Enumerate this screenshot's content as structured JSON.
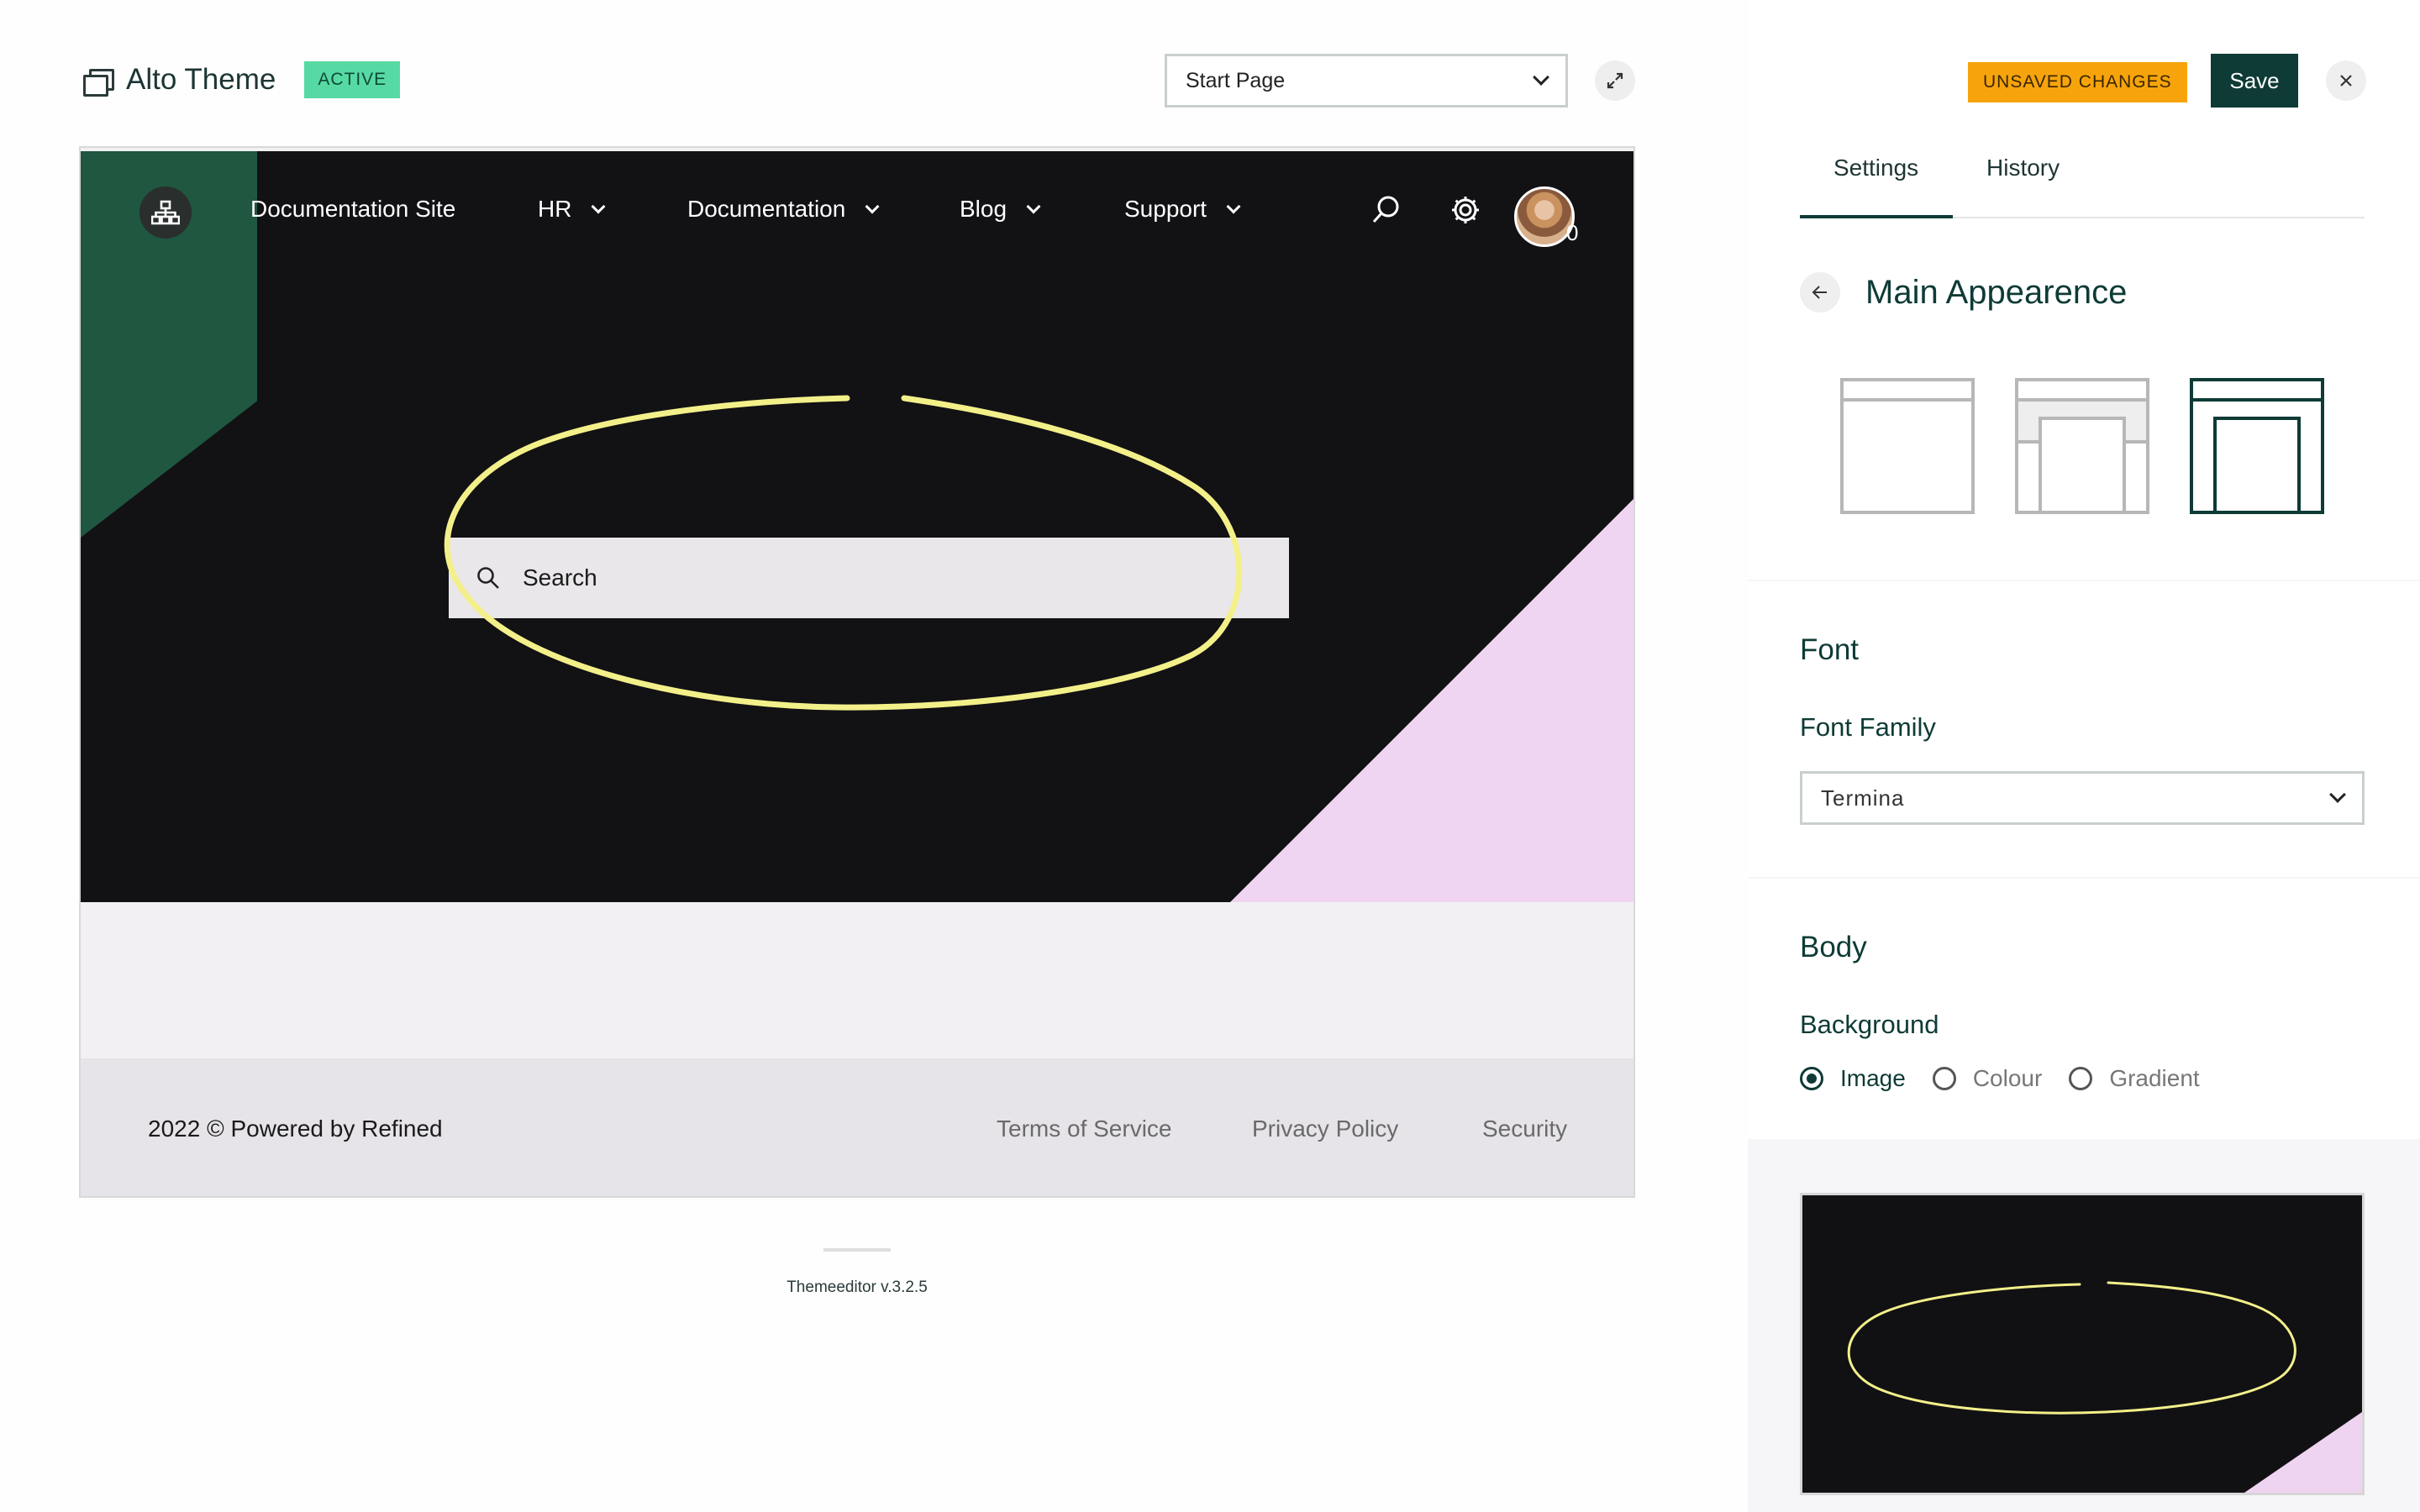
{
  "header": {
    "app_name": "Alto Theme",
    "status_badge": "ACTIVE",
    "page_select_value": "Start Page"
  },
  "preview": {
    "nav": {
      "site_name": "Documentation Site",
      "items": [
        {
          "label": "HR"
        },
        {
          "label": "Documentation"
        },
        {
          "label": "Blog"
        },
        {
          "label": "Support"
        }
      ],
      "notification_count": "0"
    },
    "search_placeholder": "Search",
    "footer": {
      "copyright": "2022 ©  Powered by Refined",
      "links": [
        "Terms of Service",
        "Privacy Policy",
        "Security"
      ]
    }
  },
  "version": "Themeeditor v.3.2.5",
  "panel": {
    "unsaved_badge": "UNSAVED CHANGES",
    "save_label": "Save",
    "tabs": [
      "Settings",
      "History"
    ],
    "active_tab": "Settings",
    "section_title": "Main Appearence",
    "font": {
      "heading": "Font",
      "family_label": "Font Family",
      "family_value": "Termina"
    },
    "body": {
      "heading": "Body",
      "background_label": "Background",
      "options": [
        "Image",
        "Colour",
        "Gradient"
      ],
      "selected": "Image"
    }
  },
  "colors": {
    "brand_dark": "#0e3b36",
    "active_badge": "#57d9a3",
    "unsaved_badge": "#f7a40c",
    "hero_bg": "#121114",
    "hero_green": "#1f5741",
    "hero_pink": "#f0d5f2",
    "highlight_yellow": "#f3f08a"
  }
}
